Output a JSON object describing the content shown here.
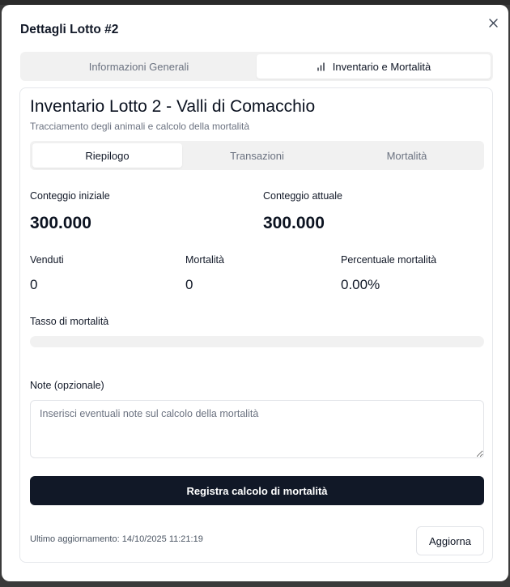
{
  "modal": {
    "title": "Dettagli Lotto #2",
    "close_icon": "close-icon"
  },
  "outer_tabs": [
    {
      "label": "Informazioni Generali",
      "active": false
    },
    {
      "label": "Inventario e Mortalità",
      "active": true,
      "icon": "bar-chart-icon"
    }
  ],
  "card": {
    "title": "Inventario Lotto 2 - Valli di Comacchio",
    "subtitle": "Tracciamento degli animali e calcolo della mortalità"
  },
  "inner_tabs": [
    {
      "label": "Riepilogo",
      "active": true
    },
    {
      "label": "Transazioni",
      "active": false
    },
    {
      "label": "Mortalità",
      "active": false
    }
  ],
  "stats": {
    "initial_label": "Conteggio iniziale",
    "initial_value": "300.000",
    "current_label": "Conteggio attuale",
    "current_value": "300.000",
    "sold_label": "Venduti",
    "sold_value": "0",
    "mortality_label": "Mortalità",
    "mortality_value": "0",
    "pct_label": "Percentuale mortalità",
    "pct_value": "0.00%"
  },
  "mortality_rate": {
    "label": "Tasso di mortalità",
    "value_percent": 0
  },
  "notes": {
    "label": "Note (opzionale)",
    "placeholder": "Inserisci eventuali note sul calcolo della mortalità",
    "value": ""
  },
  "actions": {
    "submit_label": "Registra calcolo di mortalità",
    "refresh_label": "Aggiorna"
  },
  "footer": {
    "last_updated": "Ultimo aggiornamento: 14/10/2025 11:21:19"
  },
  "colors": {
    "primary": "#111827",
    "muted_bg": "#f1f1f1",
    "muted_text": "#6b7280",
    "border": "#e5e7eb"
  }
}
